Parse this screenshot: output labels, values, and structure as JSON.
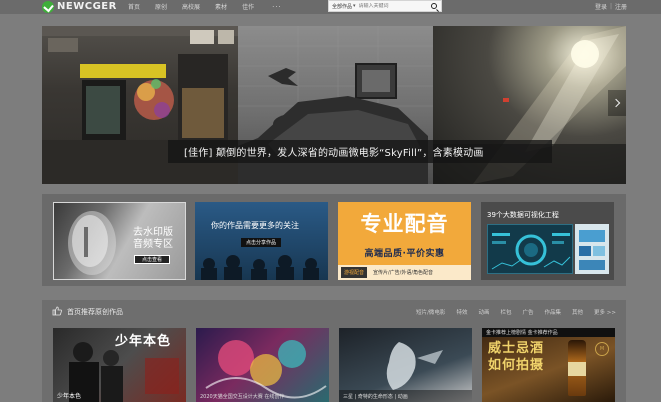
{
  "brand": {
    "name": "NEWCGER"
  },
  "nav": {
    "items": [
      "首页",
      "原创",
      "高校展",
      "素材",
      "佳作"
    ],
    "more": "···"
  },
  "search": {
    "category": "全部作品",
    "placeholder": "请输入关键词"
  },
  "user": {
    "login": "登录",
    "separator": "|",
    "register": "注册"
  },
  "banner": {
    "caption": "[佳作] 颠倒的世界，发人深省的动画微电影“SkyFill”，含素模动画"
  },
  "promos": [
    {
      "title": "去水印版\n音频专区",
      "button": "点击查看"
    },
    {
      "title": "你的作品需要更多的关注",
      "button": "点击分享作品"
    },
    {
      "title": "专业配音",
      "subtitle": "高端品质·平价实惠",
      "logo": "游视配音",
      "footer": "宣传片/广告/外语/角色配音"
    },
    {
      "title": "39个大数据可视化工程"
    }
  ],
  "recommended": {
    "title": "首页推荐原创作品",
    "tabs": [
      "短片/微电影",
      "特效",
      "动画",
      "栏包",
      "广告",
      "作品集",
      "其他",
      "更多 >>"
    ],
    "cards": [
      {
        "title": "少年本色",
        "caption": "少年本色"
      },
      {
        "caption": "2020天猫全国交互设计大赛 在线创作"
      },
      {
        "caption": "三星 | 奇特的生命形态 | 动画"
      },
      {
        "top": "金卡推荐上榜剧情 金卡推荐作品",
        "title": "威士忌酒如何拍摄",
        "logo": "M"
      }
    ]
  },
  "colors": {
    "logo_green": "#3fae3a",
    "promo_orange": "#f2a93b",
    "whisky_gold": "#f0d36b"
  }
}
